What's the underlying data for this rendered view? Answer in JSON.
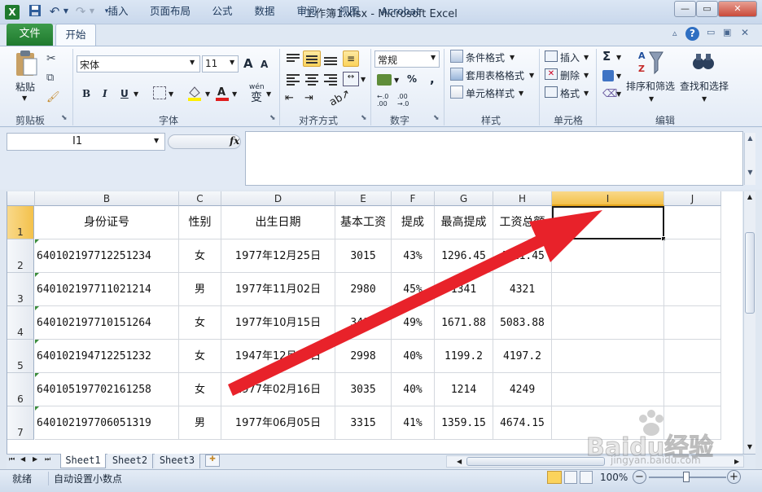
{
  "window": {
    "title": "工作簿1.xlsx - Microsoft Excel",
    "minimize": "▭",
    "restore": "▭",
    "close": "✕"
  },
  "qat": {
    "undo": "↶",
    "redo": "↷"
  },
  "tabs": {
    "file": "文件",
    "home": "开始",
    "items": [
      "插入",
      "页面布局",
      "公式",
      "数据",
      "审阅",
      "视图",
      "Acrobat"
    ]
  },
  "ribbon": {
    "clipboard": {
      "paste": "粘贴",
      "group": "剪贴板"
    },
    "font": {
      "name": "宋体",
      "size": "11",
      "bold": "B",
      "italic": "I",
      "underline": "U",
      "group": "字体",
      "grow": "A",
      "shrink": "A",
      "wen": "wén",
      "wen_char": "变"
    },
    "alignment": {
      "group": "对齐方式"
    },
    "number": {
      "format": "常规",
      "percent": "%",
      "comma": ",",
      "group": "数字",
      "inc": "←.0 .00",
      "dec": ".00 →.0"
    },
    "styles": {
      "conditional": "条件格式",
      "table": "套用表格格式",
      "cell_styles": "单元格样式",
      "group": "样式"
    },
    "cells": {
      "insert": "插入",
      "delete": "删除",
      "format": "格式",
      "group": "单元格"
    },
    "editing": {
      "sigma": "Σ",
      "sort": "排序和筛选",
      "find": "查找和选择",
      "group": "编辑"
    }
  },
  "formula_bar": {
    "name_box": "I1",
    "fx": "fx",
    "value": ""
  },
  "columns": [
    "B",
    "C",
    "D",
    "E",
    "F",
    "G",
    "H",
    "I",
    "J"
  ],
  "rows": [
    "1",
    "2",
    "3",
    "4",
    "5",
    "6",
    "7"
  ],
  "headers": [
    "身份证号",
    "性别",
    "出生日期",
    "基本工资",
    "提成",
    "最高提成",
    "工资总额",
    ""
  ],
  "table": [
    [
      "640102197712251234",
      "女",
      "1977年12月25日",
      "3015",
      "43%",
      "1296.45",
      "4311.45"
    ],
    [
      "640102197711021214",
      "男",
      "1977年11月02日",
      "2980",
      "45%",
      "1341",
      "4321"
    ],
    [
      "640102197710151264",
      "女",
      "1977年10月15日",
      "3412",
      "49%",
      "1671.88",
      "5083.88"
    ],
    [
      "640102194712251232",
      "女",
      "1947年12月25日",
      "2998",
      "40%",
      "1199.2",
      "4197.2"
    ],
    [
      "640105197702161258",
      "女",
      "1977年02月16日",
      "3035",
      "40%",
      "1214",
      "4249"
    ],
    [
      "640102197706051319",
      "男",
      "1977年06月05日",
      "3315",
      "41%",
      "1359.15",
      "4674.15"
    ]
  ],
  "sheets": [
    "Sheet1",
    "Sheet2",
    "Sheet3"
  ],
  "status": {
    "ready": "就绪",
    "auto_decimal": "自动设置小数点",
    "zoom": "100%",
    "zoom_minus": "−",
    "zoom_plus": "+"
  },
  "watermark": {
    "brand": "Baidu经验",
    "url": "jingyan.baidu.com"
  },
  "accent": {
    "excel_green": "#1f7a2e",
    "selection": "#f3c14b",
    "arrow_red": "#e8222a"
  }
}
